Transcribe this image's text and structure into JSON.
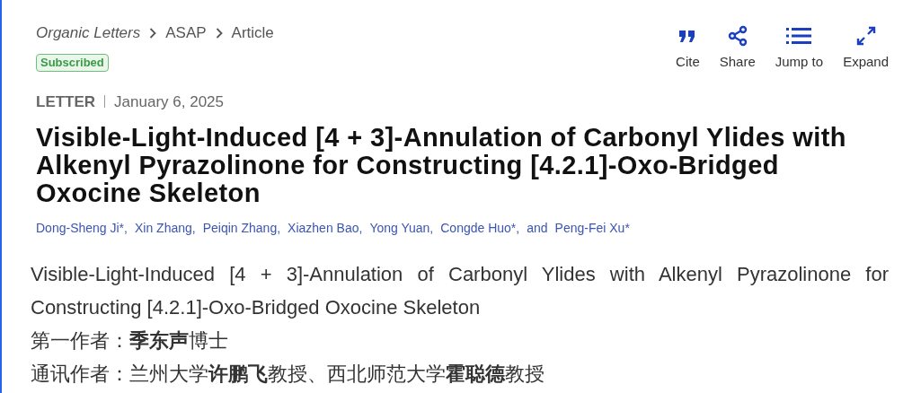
{
  "breadcrumb": [
    {
      "label": "Organic Letters",
      "italic": true
    },
    {
      "label": "ASAP",
      "italic": false
    },
    {
      "label": "Article",
      "italic": false
    }
  ],
  "badge": "Subscribed",
  "actions": [
    {
      "kind": "cite",
      "label": "Cite"
    },
    {
      "kind": "share",
      "label": "Share"
    },
    {
      "kind": "jump",
      "label": "Jump to"
    },
    {
      "kind": "expand",
      "label": "Expand"
    }
  ],
  "article_type": "LETTER",
  "date": "January 6, 2025",
  "title": "Visible-Light-Induced [4 + 3]-Annulation of Carbonyl Ylides with Alkenyl Pyrazolinone for Constructing [4.2.1]-Oxo-Bridged Oxocine Skeleton",
  "authors": [
    {
      "name": "Dong-Sheng Ji*,"
    },
    {
      "name": "Xin Zhang,"
    },
    {
      "name": "Peiqin Zhang,"
    },
    {
      "name": "Xiazhen Bao,"
    },
    {
      "name": "Yong Yuan,"
    },
    {
      "name": "Congde Huo*,"
    },
    {
      "name": "Peng-Fei Xu*"
    }
  ],
  "authors_conjunction": "and",
  "body": [
    "Visible-Light-Induced [4 + 3]-Annulation of Carbonyl Ylides with Alkenyl Pyrazolinone for Constructing [4.2.1]-Oxo-Bridged Oxocine Skeleton",
    "第一作者：**季东声**博士",
    "通讯作者：兰州大学**许鹏飞**教授、西北师范大学**霍聪德**教授"
  ]
}
